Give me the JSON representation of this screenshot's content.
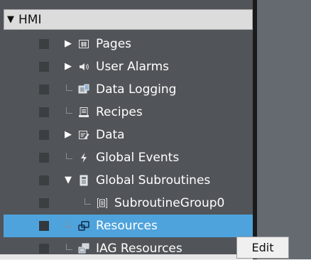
{
  "tree": {
    "root_label": "HMI",
    "items": [
      {
        "label": "Pages",
        "icon": "pages-icon",
        "expander": "collapsed"
      },
      {
        "label": "User Alarms",
        "icon": "alarm-speaker-icon",
        "expander": "collapsed"
      },
      {
        "label": "Data Logging",
        "icon": "data-logging-icon",
        "expander": "none"
      },
      {
        "label": "Recipes",
        "icon": "recipes-icon",
        "expander": "none"
      },
      {
        "label": "Data",
        "icon": "data-icon",
        "expander": "collapsed"
      },
      {
        "label": "Global Events",
        "icon": "lightning-icon",
        "expander": "none"
      },
      {
        "label": "Global Subroutines",
        "icon": "subroutines-icon",
        "expander": "expanded"
      },
      {
        "label": "SubroutineGroup0",
        "icon": "subroutine-group-icon",
        "expander": "none"
      },
      {
        "label": "Resources",
        "icon": "resources-icon",
        "expander": "none",
        "selected": true
      },
      {
        "label": "IAG Resources",
        "icon": "iag-resources-icon",
        "expander": "none"
      }
    ]
  },
  "context_menu": {
    "edit_label": "Edit"
  },
  "colors": {
    "panel": "#515458",
    "selection": "#4fa3dc",
    "header": "#dcdcdc"
  }
}
